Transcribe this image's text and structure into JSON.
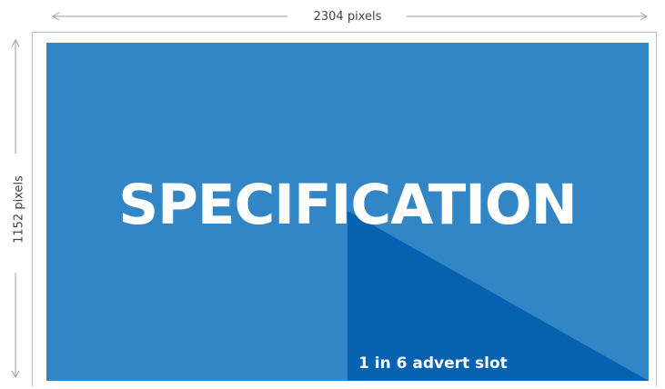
{
  "dimensions": {
    "width_label": "2304 pixels",
    "height_label": "1152 pixels"
  },
  "panel": {
    "title": "SPECIFICATION",
    "slot_label": "1 in 6 advert slot",
    "slot_fraction": "1 in 6"
  },
  "colors": {
    "panel_background": "#3286c6",
    "slot_fill": "#0462b0",
    "text": "#ffffff",
    "dimension_lines": "#9e9e9e"
  }
}
